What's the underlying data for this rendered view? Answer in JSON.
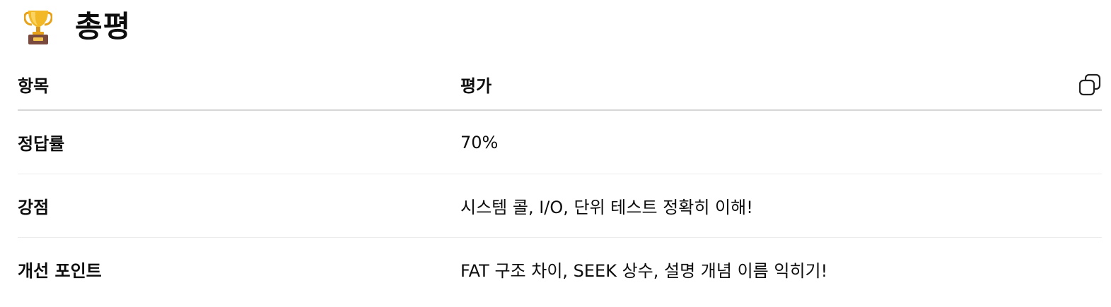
{
  "heading": {
    "icon": "trophy-icon",
    "title": "총평"
  },
  "table": {
    "headers": [
      "항목",
      "평가"
    ],
    "rows": [
      {
        "item": "정답률",
        "evaluation": "70%"
      },
      {
        "item": "강점",
        "evaluation": "시스템 콜, I/O, 단위 테스트 정확히 이해!"
      },
      {
        "item": "개선 포인트",
        "evaluation": "FAT 구조 차이, SEEK 상수, 설명 개념 이름 익히기!"
      }
    ],
    "copy_icon": "copy-icon"
  },
  "colors": {
    "text": "#0d0d0d",
    "header_rule": "#d6d6d6",
    "row_rule": "#ececec",
    "trophy_gold": "#f2b826",
    "trophy_base": "#7a4a3f"
  }
}
